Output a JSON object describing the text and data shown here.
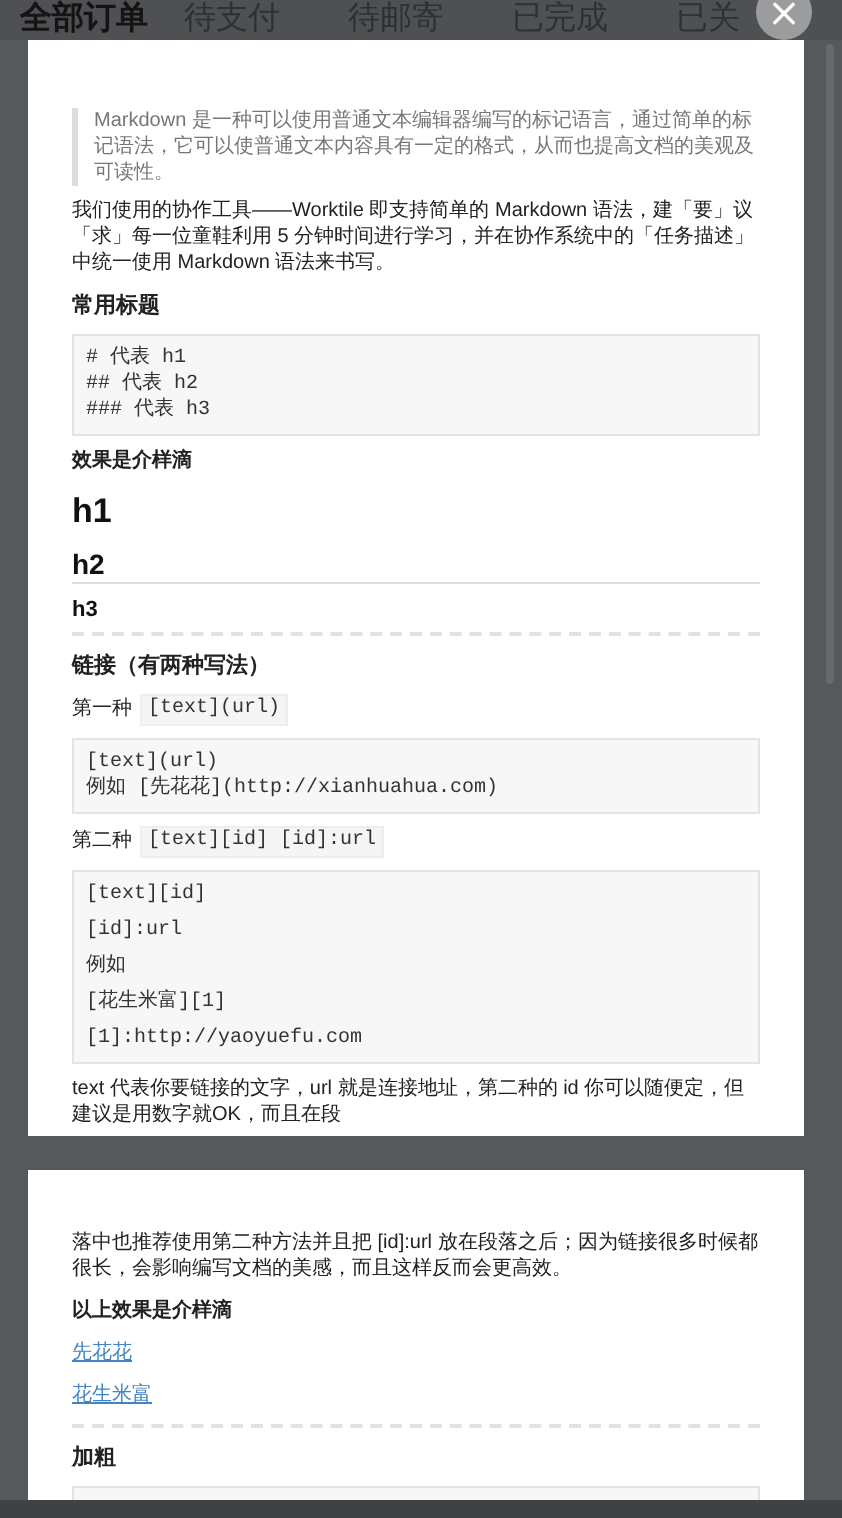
{
  "tabs": [
    {
      "label": "全部订单",
      "selected": true
    },
    {
      "label": "待支付",
      "selected": false
    },
    {
      "label": "待邮寄",
      "selected": false
    },
    {
      "label": "已完成",
      "selected": false
    },
    {
      "label": "已关",
      "selected": false
    }
  ],
  "close_button": {
    "label": "×"
  },
  "pages": [
    {
      "blocks": [
        {
          "kind": "quote",
          "text": "Markdown 是一种可以使用普通文本编辑器编写的标记语言，通过简单的标记语法，它可以使普通文本内容具有一定的格式，从而也提高文档的美观及可读性。"
        },
        {
          "kind": "paragraph",
          "text": "我们使用的协作工具——Worktile 即支持简单的 Markdown 语法，建「要」议「求」每一位童鞋利用 5 分钟时间进行学习，并在协作系统中的「任务描述」中统一使用 Markdown 语法来书写。"
        },
        {
          "kind": "heading",
          "text": "常用标题"
        },
        {
          "kind": "code",
          "lines": [
            "# 代表 h1",
            "## 代表 h2",
            "### 代表 h3"
          ]
        },
        {
          "kind": "label",
          "text": "效果是介样滴"
        },
        {
          "kind": "h1",
          "text": "h1"
        },
        {
          "kind": "h2",
          "text": "h2"
        },
        {
          "kind": "h3",
          "text": "h3"
        },
        {
          "kind": "rule"
        },
        {
          "kind": "heading",
          "text": "链接（有两种写法）"
        },
        {
          "kind": "inline_code_line",
          "text": "第一种",
          "code": "[text](url)"
        },
        {
          "kind": "code",
          "lines": [
            "[text](url)",
            "例如 [先花花](http://xianhuahua.com)"
          ]
        },
        {
          "kind": "inline_code_line",
          "text": "第二种",
          "code": "[text][id] [id]:url"
        },
        {
          "kind": "code_spaced",
          "lines": [
            "[text][id]",
            "[id]:url",
            "例如",
            "[花生米富][1]",
            "[1]:http://yaoyuefu.com"
          ]
        },
        {
          "kind": "paragraph",
          "text": "text 代表你要链接的文字，url 就是连接地址，第二种的 id 你可以随便定，但建议是用数字就OK，而且在段"
        }
      ]
    },
    {
      "blocks": [
        {
          "kind": "paragraph",
          "text": "落中也推荐使用第二种方法并且把 [id]:url 放在段落之后；因为链接很多时候都很长，会影响编写文档的美感，而且这样反而会更高效。"
        },
        {
          "kind": "label",
          "text": "以上效果是介样滴"
        },
        {
          "kind": "link",
          "text": "先花花"
        },
        {
          "kind": "link",
          "text": "花生米富"
        },
        {
          "kind": "rule"
        },
        {
          "kind": "heading",
          "text": "加粗"
        },
        {
          "kind": "code_stub"
        }
      ]
    }
  ]
}
